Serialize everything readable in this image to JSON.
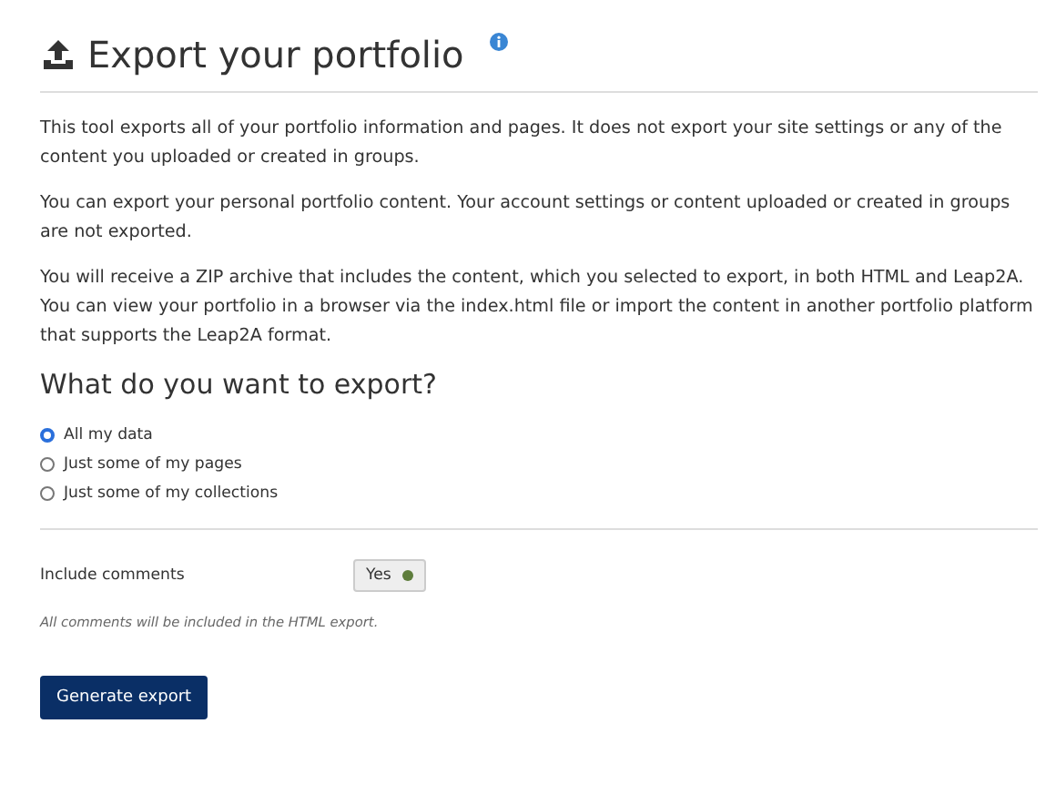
{
  "title": "Export your portfolio",
  "paragraphs": [
    "This tool exports all of your portfolio information and pages. It does not export your site settings or any of the content you uploaded or created in groups.",
    "You can export your personal portfolio content. Your account settings or content uploaded or created in groups are not exported.",
    "You will receive a ZIP archive that includes the content, which you selected to export, in both HTML and Leap2A. You can view your portfolio in a browser via the index.html file or import the content in another portfolio platform that supports the Leap2A format."
  ],
  "question": "What do you want to export?",
  "options": [
    {
      "label": "All my data",
      "selected": true
    },
    {
      "label": "Just some of my pages",
      "selected": false
    },
    {
      "label": "Just some of my collections",
      "selected": false
    }
  ],
  "include_comments": {
    "label": "Include comments",
    "value": "Yes",
    "on": true,
    "description": "All comments will be included in the HTML export."
  },
  "button": "Generate export"
}
